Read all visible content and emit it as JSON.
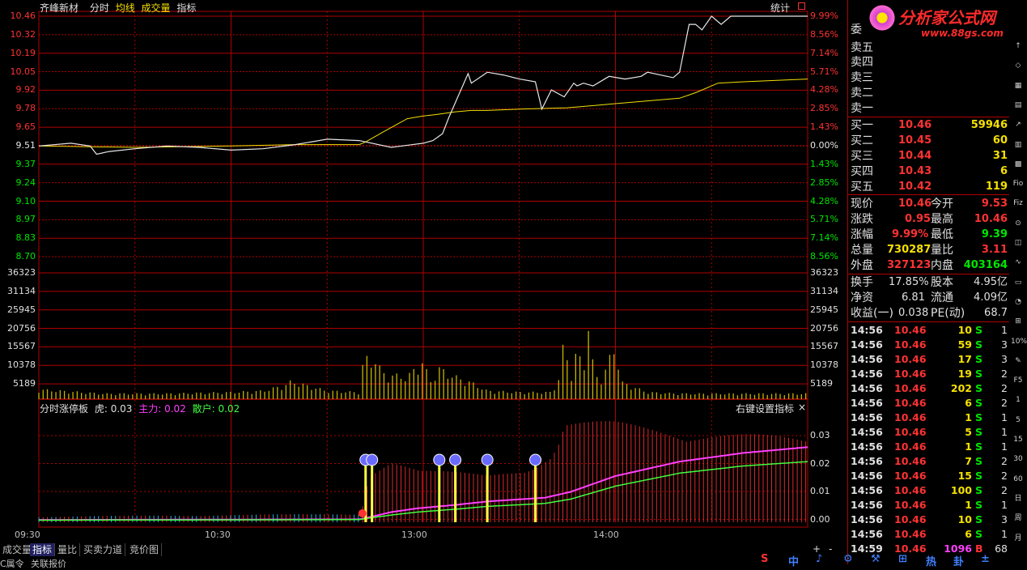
{
  "header": {
    "stock_name": "齐峰新材",
    "mode_label": "分时",
    "avg_label": "均线",
    "vol_label": "成交量",
    "indicator_label": "指标",
    "stats_label": "统计"
  },
  "logo": {
    "title": "分析家公式网",
    "url": "www.88gs.com"
  },
  "price_axis": {
    "left": [
      "10.46",
      "10.32",
      "10.19",
      "10.05",
      "9.92",
      "9.78",
      "9.65",
      "9.51",
      "9.37",
      "9.24",
      "9.10",
      "8.97",
      "8.83",
      "8.70"
    ],
    "right": [
      "9.99%",
      "8.56%",
      "7.14%",
      "5.71%",
      "4.28%",
      "2.85%",
      "1.43%",
      "0.00%",
      "1.43%",
      "2.85%",
      "4.28%",
      "5.71%",
      "7.14%",
      "8.56%"
    ]
  },
  "volume_axis": [
    "36323",
    "31134",
    "25945",
    "20756",
    "15567",
    "10378",
    "5189"
  ],
  "indicator": {
    "name": "分时涨停板",
    "tiger_label": "虎: 0.03",
    "main_label": "主力: 0.02",
    "retail_label": "散户: 0.02",
    "right_click_hint": "右键设置指标",
    "close": "×",
    "axis": [
      "0.03",
      "0.02",
      "0.01",
      "0.00"
    ]
  },
  "time_axis": [
    "09:30",
    "10:30",
    "13:00",
    "14:00"
  ],
  "bottom_tabs": [
    "成交量",
    "指标",
    "量比",
    "买卖力道",
    "竞价图"
  ],
  "bottom_row2": [
    "C属令",
    "关联报价"
  ],
  "nav_buttons": [
    "+",
    "-"
  ],
  "order_book": {
    "wei_label": "委",
    "sells": [
      {
        "label": "卖五",
        "price": "",
        "vol": ""
      },
      {
        "label": "卖四",
        "price": "",
        "vol": ""
      },
      {
        "label": "卖三",
        "price": "",
        "vol": ""
      },
      {
        "label": "卖二",
        "price": "",
        "vol": ""
      },
      {
        "label": "卖一",
        "price": "",
        "vol": ""
      }
    ],
    "buys": [
      {
        "label": "买一",
        "price": "10.46",
        "vol": "59946"
      },
      {
        "label": "买二",
        "price": "10.45",
        "vol": "60"
      },
      {
        "label": "买三",
        "price": "10.44",
        "vol": "31"
      },
      {
        "label": "买四",
        "price": "10.43",
        "vol": "6"
      },
      {
        "label": "买五",
        "price": "10.42",
        "vol": "119"
      }
    ]
  },
  "quote": [
    {
      "l1": "现价",
      "v1": "10.46",
      "l2": "今开",
      "v2": "9.53"
    },
    {
      "l1": "涨跌",
      "v1": "0.95",
      "l2": "最高",
      "v2": "10.46"
    },
    {
      "l1": "涨幅",
      "v1": "9.99%",
      "l2": "最低",
      "v2": "9.39"
    },
    {
      "l1": "总量",
      "v1": "730287",
      "l2": "量比",
      "v2": "3.11"
    },
    {
      "l1": "外盘",
      "v1": "327123",
      "l2": "内盘",
      "v2": "403164"
    }
  ],
  "fundamentals": [
    {
      "l1": "换手",
      "v1": "17.85%",
      "l2": "股本",
      "v2": "4.95亿"
    },
    {
      "l1": "净资",
      "v1": "6.81",
      "l2": "流通",
      "v2": "4.09亿"
    },
    {
      "l1": "收益(一)",
      "v1": "0.038",
      "l2": "PE(动)",
      "v2": "68.7"
    }
  ],
  "ticks": [
    {
      "time": "14:56",
      "price": "10.46",
      "vol": "10",
      "side": "S",
      "n": "1"
    },
    {
      "time": "14:56",
      "price": "10.46",
      "vol": "59",
      "side": "S",
      "n": "3"
    },
    {
      "time": "14:56",
      "price": "10.46",
      "vol": "17",
      "side": "S",
      "n": "3"
    },
    {
      "time": "14:56",
      "price": "10.46",
      "vol": "19",
      "side": "S",
      "n": "2"
    },
    {
      "time": "14:56",
      "price": "10.46",
      "vol": "202",
      "side": "S",
      "n": "2"
    },
    {
      "time": "14:56",
      "price": "10.46",
      "vol": "6",
      "side": "S",
      "n": "2"
    },
    {
      "time": "14:56",
      "price": "10.46",
      "vol": "1",
      "side": "S",
      "n": "1"
    },
    {
      "time": "14:56",
      "price": "10.46",
      "vol": "5",
      "side": "S",
      "n": "1"
    },
    {
      "time": "14:56",
      "price": "10.46",
      "vol": "1",
      "side": "S",
      "n": "1"
    },
    {
      "time": "14:56",
      "price": "10.46",
      "vol": "7",
      "side": "S",
      "n": "2"
    },
    {
      "time": "14:56",
      "price": "10.46",
      "vol": "15",
      "side": "S",
      "n": "2"
    },
    {
      "time": "14:56",
      "price": "10.46",
      "vol": "100",
      "side": "S",
      "n": "2"
    },
    {
      "time": "14:56",
      "price": "10.46",
      "vol": "1",
      "side": "S",
      "n": "1"
    },
    {
      "time": "14:56",
      "price": "10.46",
      "vol": "10",
      "side": "S",
      "n": "3"
    },
    {
      "time": "14:56",
      "price": "10.46",
      "vol": "6",
      "side": "S",
      "n": "1"
    },
    {
      "time": "14:59",
      "price": "10.46",
      "vol": "1096",
      "side": "B",
      "n": "68"
    }
  ],
  "right_toolbar": [
    "↑",
    "◇",
    "▦",
    "▤",
    "↗",
    "▥",
    "▩",
    "Fio",
    "Fiz",
    "⊙",
    "◫",
    "∿",
    "▭",
    "◔",
    "⊞",
    "10%",
    "✎",
    "F5",
    "1",
    "5",
    "15",
    "30",
    "60",
    "日",
    "周",
    "月"
  ],
  "status_bar": [
    "S",
    "中",
    "♪",
    "⚙",
    "⚒",
    "⊞",
    "热",
    "卦",
    "±"
  ],
  "colors": {
    "up": "#ff3232",
    "down": "#00e600",
    "neutral": "#e8e8e8",
    "grid": "#b00000",
    "avg": "#f5e000",
    "vol": "#c8b400",
    "bar": "#ff3232",
    "main": "#ff40ff",
    "retail": "#40ff40"
  },
  "chart_data": {
    "type": "line",
    "prev_close": 9.51,
    "ylim": [
      8.7,
      10.46
    ],
    "price_series": {
      "name": "分时",
      "t": [
        0,
        10,
        16,
        18,
        22,
        30,
        40,
        50,
        60,
        70,
        80,
        90,
        100,
        110,
        120,
        123,
        126,
        128,
        131,
        134,
        135,
        140,
        145,
        150,
        155,
        157,
        160,
        164,
        167,
        168,
        170,
        173,
        178,
        183,
        188,
        190,
        194,
        198,
        200,
        203,
        205,
        207,
        210,
        213,
        216,
        220,
        225,
        230,
        234,
        236,
        240
      ],
      "v": [
        9.51,
        9.53,
        9.51,
        9.45,
        9.47,
        9.49,
        9.51,
        9.5,
        9.48,
        9.49,
        9.52,
        9.56,
        9.55,
        9.5,
        9.53,
        9.55,
        9.6,
        9.72,
        9.88,
        10.04,
        9.97,
        10.05,
        10.03,
        10.0,
        9.98,
        9.78,
        9.92,
        9.87,
        9.97,
        9.95,
        9.97,
        9.95,
        10.02,
        10.0,
        10.02,
        10.05,
        10.03,
        10.01,
        10.05,
        10.4,
        10.4,
        10.36,
        10.46,
        10.4,
        10.46,
        10.46,
        10.46,
        10.46,
        10.46,
        10.46,
        10.46
      ]
    },
    "avg_series": {
      "name": "均线",
      "t": [
        0,
        30,
        60,
        80,
        100,
        102,
        108,
        115,
        120,
        124,
        130,
        135,
        140,
        150,
        165,
        175,
        180,
        190,
        200,
        205,
        212,
        220,
        240
      ],
      "v": [
        9.51,
        9.5,
        9.51,
        9.52,
        9.52,
        9.54,
        9.62,
        9.71,
        9.73,
        9.74,
        9.76,
        9.77,
        9.77,
        9.78,
        9.79,
        9.81,
        9.82,
        9.84,
        9.86,
        9.9,
        9.97,
        9.98,
        10.0
      ]
    },
    "volume": {
      "ylim": [
        0,
        41512
      ],
      "bars": [
        [
          0,
          3500
        ],
        [
          20,
          2000
        ],
        [
          40,
          2000
        ],
        [
          60,
          2500
        ],
        [
          70,
          3000
        ],
        [
          75,
          4500
        ],
        [
          78,
          5500
        ],
        [
          79,
          7000
        ],
        [
          80,
          6000
        ],
        [
          90,
          3000
        ],
        [
          100,
          2500
        ],
        [
          101,
          12000
        ],
        [
          102,
          14000
        ],
        [
          103,
          15000
        ],
        [
          104,
          13000
        ],
        [
          105,
          15000
        ],
        [
          106,
          12000
        ],
        [
          107,
          10000
        ],
        [
          108,
          9000
        ],
        [
          115,
          8000
        ],
        [
          120,
          14000
        ],
        [
          122,
          6000
        ],
        [
          125,
          11000
        ],
        [
          130,
          8000
        ],
        [
          135,
          6000
        ],
        [
          140,
          3000
        ],
        [
          150,
          2500
        ],
        [
          160,
          2500
        ],
        [
          162,
          6000
        ],
        [
          163,
          12000
        ],
        [
          164,
          22000
        ],
        [
          165,
          14000
        ],
        [
          166,
          8000
        ],
        [
          168,
          18000
        ],
        [
          169,
          14000
        ],
        [
          170,
          6000
        ],
        [
          171,
          34000
        ],
        [
          172,
          24000
        ],
        [
          173,
          12000
        ],
        [
          174,
          8000
        ],
        [
          176,
          8000
        ],
        [
          180,
          20000
        ],
        [
          181,
          12000
        ],
        [
          182,
          6000
        ],
        [
          190,
          2500
        ],
        [
          200,
          2000
        ],
        [
          240,
          2000
        ]
      ]
    },
    "indicator_series": {
      "ylim": [
        0,
        0.035
      ],
      "main": {
        "t": [
          0,
          100,
          101,
          110,
          118,
          130,
          140,
          158,
          166,
          180,
          200,
          220,
          240
        ],
        "v": [
          0.0008,
          0.001,
          0.0012,
          0.0035,
          0.0048,
          0.006,
          0.0072,
          0.0085,
          0.0105,
          0.016,
          0.021,
          0.024,
          0.026
        ]
      },
      "retail": {
        "t": [
          0,
          100,
          101,
          110,
          118,
          130,
          140,
          158,
          166,
          180,
          200,
          220,
          240
        ],
        "v": [
          0.0007,
          0.0009,
          0.0011,
          0.0025,
          0.0035,
          0.0045,
          0.0055,
          0.0065,
          0.008,
          0.0125,
          0.017,
          0.0195,
          0.021
        ]
      },
      "signals": [
        102,
        104,
        125,
        130,
        140,
        155
      ],
      "bar_level": {
        "t": [
          0,
          100,
          101,
          102,
          103,
          110,
          119,
          140,
          155,
          160,
          162,
          163,
          164,
          180,
          200,
          220,
          240
        ],
        "v": [
          0.002,
          0.003,
          0.006,
          0.012,
          0.018,
          0.022,
          0.018,
          0.017,
          0.021,
          0.024,
          0.028,
          0.03,
          0.035,
          0.035,
          0.033,
          0.031,
          0.029
        ]
      }
    }
  }
}
